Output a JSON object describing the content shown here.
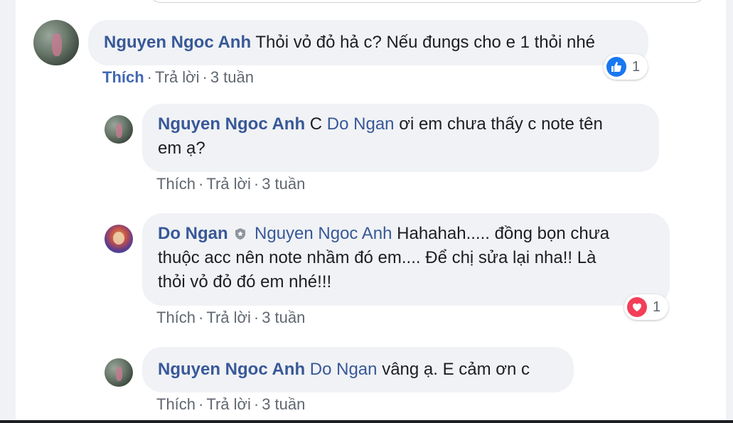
{
  "comments": [
    {
      "author": "Nguyen Ngoc Anh",
      "text": "Thỏi vỏ đỏ hả c? Nếu đungs cho e 1 thỏi nhé",
      "actions": {
        "like": "Thích",
        "reply": "Trả lời",
        "time": "3 tuần"
      },
      "reaction": {
        "icon": "like-reaction-icon",
        "count": "1"
      }
    },
    {
      "author": "Nguyen Ngoc Anh",
      "mention_prefix": "C",
      "mention": "Do Ngan",
      "text_line1": "ơi em chưa thấy c note tên",
      "text_line2": "em ạ?",
      "actions": {
        "like": "Thích",
        "reply": "Trả lời",
        "time": "3 tuần"
      }
    },
    {
      "author": "Do Ngan",
      "mention": "Nguyen Ngoc Anh",
      "text_line1": "Hahahah..... đồng bọn chưa",
      "text_line2": "thuộc acc nên note nhầm đó em.... Để chị sửa lại nha!! Là",
      "text_line3": "thỏi vỏ đỏ đó em nhé!!!",
      "actions": {
        "like": "Thích",
        "reply": "Trả lời",
        "time": "3 tuần"
      },
      "reaction": {
        "icon": "love-reaction-icon",
        "count": "1"
      }
    },
    {
      "author": "Nguyen Ngoc Anh",
      "mention": "Do Ngan",
      "text": "vâng ạ. E cảm ơn c",
      "actions": {
        "like": "Thích",
        "reply": "Trả lời",
        "time": "3 tuần"
      }
    }
  ],
  "separator": "·",
  "colors": {
    "author": "#385898",
    "bubble": "#f0f2f5",
    "like": "#1877f2",
    "love": "#f33e58"
  }
}
